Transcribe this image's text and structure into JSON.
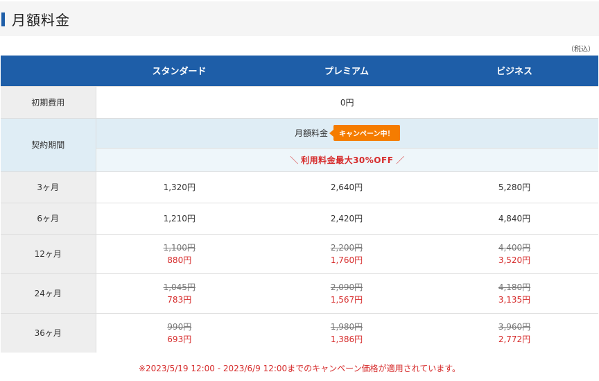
{
  "section": {
    "title": "月額料金",
    "tax_note": "（税込）"
  },
  "table": {
    "plans": [
      "スタンダード",
      "プレミアム",
      "ビジネス"
    ],
    "initial_fee": {
      "label": "初期費用",
      "value": "0円"
    },
    "contract": {
      "label": "契約期間",
      "monthly_label": "月額料金",
      "campaign_badge": "キャンペーン中！",
      "discount_open": "＼",
      "discount_text": "利用料金最大30%OFF",
      "discount_close": "／"
    },
    "rows": [
      {
        "period": "3ヶ月",
        "prices": [
          {
            "current": "1,320円"
          },
          {
            "current": "2,640円"
          },
          {
            "current": "5,280円"
          }
        ]
      },
      {
        "period": "6ヶ月",
        "prices": [
          {
            "current": "1,210円"
          },
          {
            "current": "2,420円"
          },
          {
            "current": "4,840円"
          }
        ]
      },
      {
        "period": "12ヶ月",
        "prices": [
          {
            "old": "1,100円",
            "current": "880円"
          },
          {
            "old": "2,200円",
            "current": "1,760円"
          },
          {
            "old": "4,400円",
            "current": "3,520円"
          }
        ]
      },
      {
        "period": "24ヶ月",
        "prices": [
          {
            "old": "1,045円",
            "current": "783円"
          },
          {
            "old": "2,090円",
            "current": "1,567円"
          },
          {
            "old": "4,180円",
            "current": "3,135円"
          }
        ]
      },
      {
        "period": "36ヶ月",
        "prices": [
          {
            "old": "990円",
            "current": "693円"
          },
          {
            "old": "1,980円",
            "current": "1,386円"
          },
          {
            "old": "3,960円",
            "current": "2,772円"
          }
        ]
      }
    ]
  },
  "footnote": "※2023/5/19 12:00 - 2023/6/9 12:00までのキャンペーン価格が適用されています。",
  "colors": {
    "header_blue": "#1e5ea8",
    "accent_orange": "#f57c00",
    "sale_red": "#d62b2b"
  }
}
